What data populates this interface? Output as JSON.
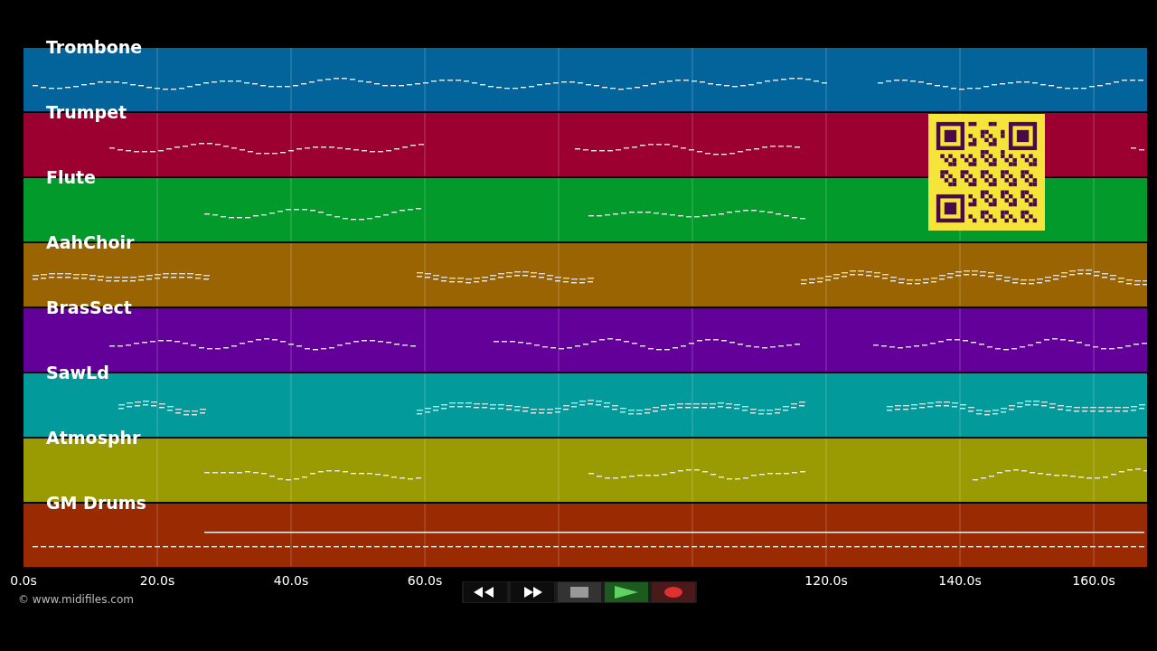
{
  "tracks": [
    {
      "name": "Trombone",
      "color": "#02649a"
    },
    {
      "name": "Trumpet",
      "color": "#9b0030"
    },
    {
      "name": "Flute",
      "color": "#029a2a"
    },
    {
      "name": "AahChoir",
      "color": "#9a6402"
    },
    {
      "name": "BrasSect",
      "color": "#64009a"
    },
    {
      "name": "SawLd",
      "color": "#029a9a"
    },
    {
      "name": "Atmosphr",
      "color": "#9a9a02"
    },
    {
      "name": "GM Drums",
      "color": "#9a2a02"
    }
  ],
  "time_axis": {
    "ticks_left": [
      "0.0s",
      "20.0s",
      "40.0s",
      "60.0s"
    ],
    "ticks_right": [
      "120.0s",
      "140.0s",
      "160.0s"
    ]
  },
  "transport": {
    "buttons": [
      {
        "kind": "rewind"
      },
      {
        "kind": "forward"
      },
      {
        "kind": "stop"
      },
      {
        "kind": "play"
      },
      {
        "kind": "record"
      }
    ]
  },
  "copyright": "© www.midifiles.com"
}
